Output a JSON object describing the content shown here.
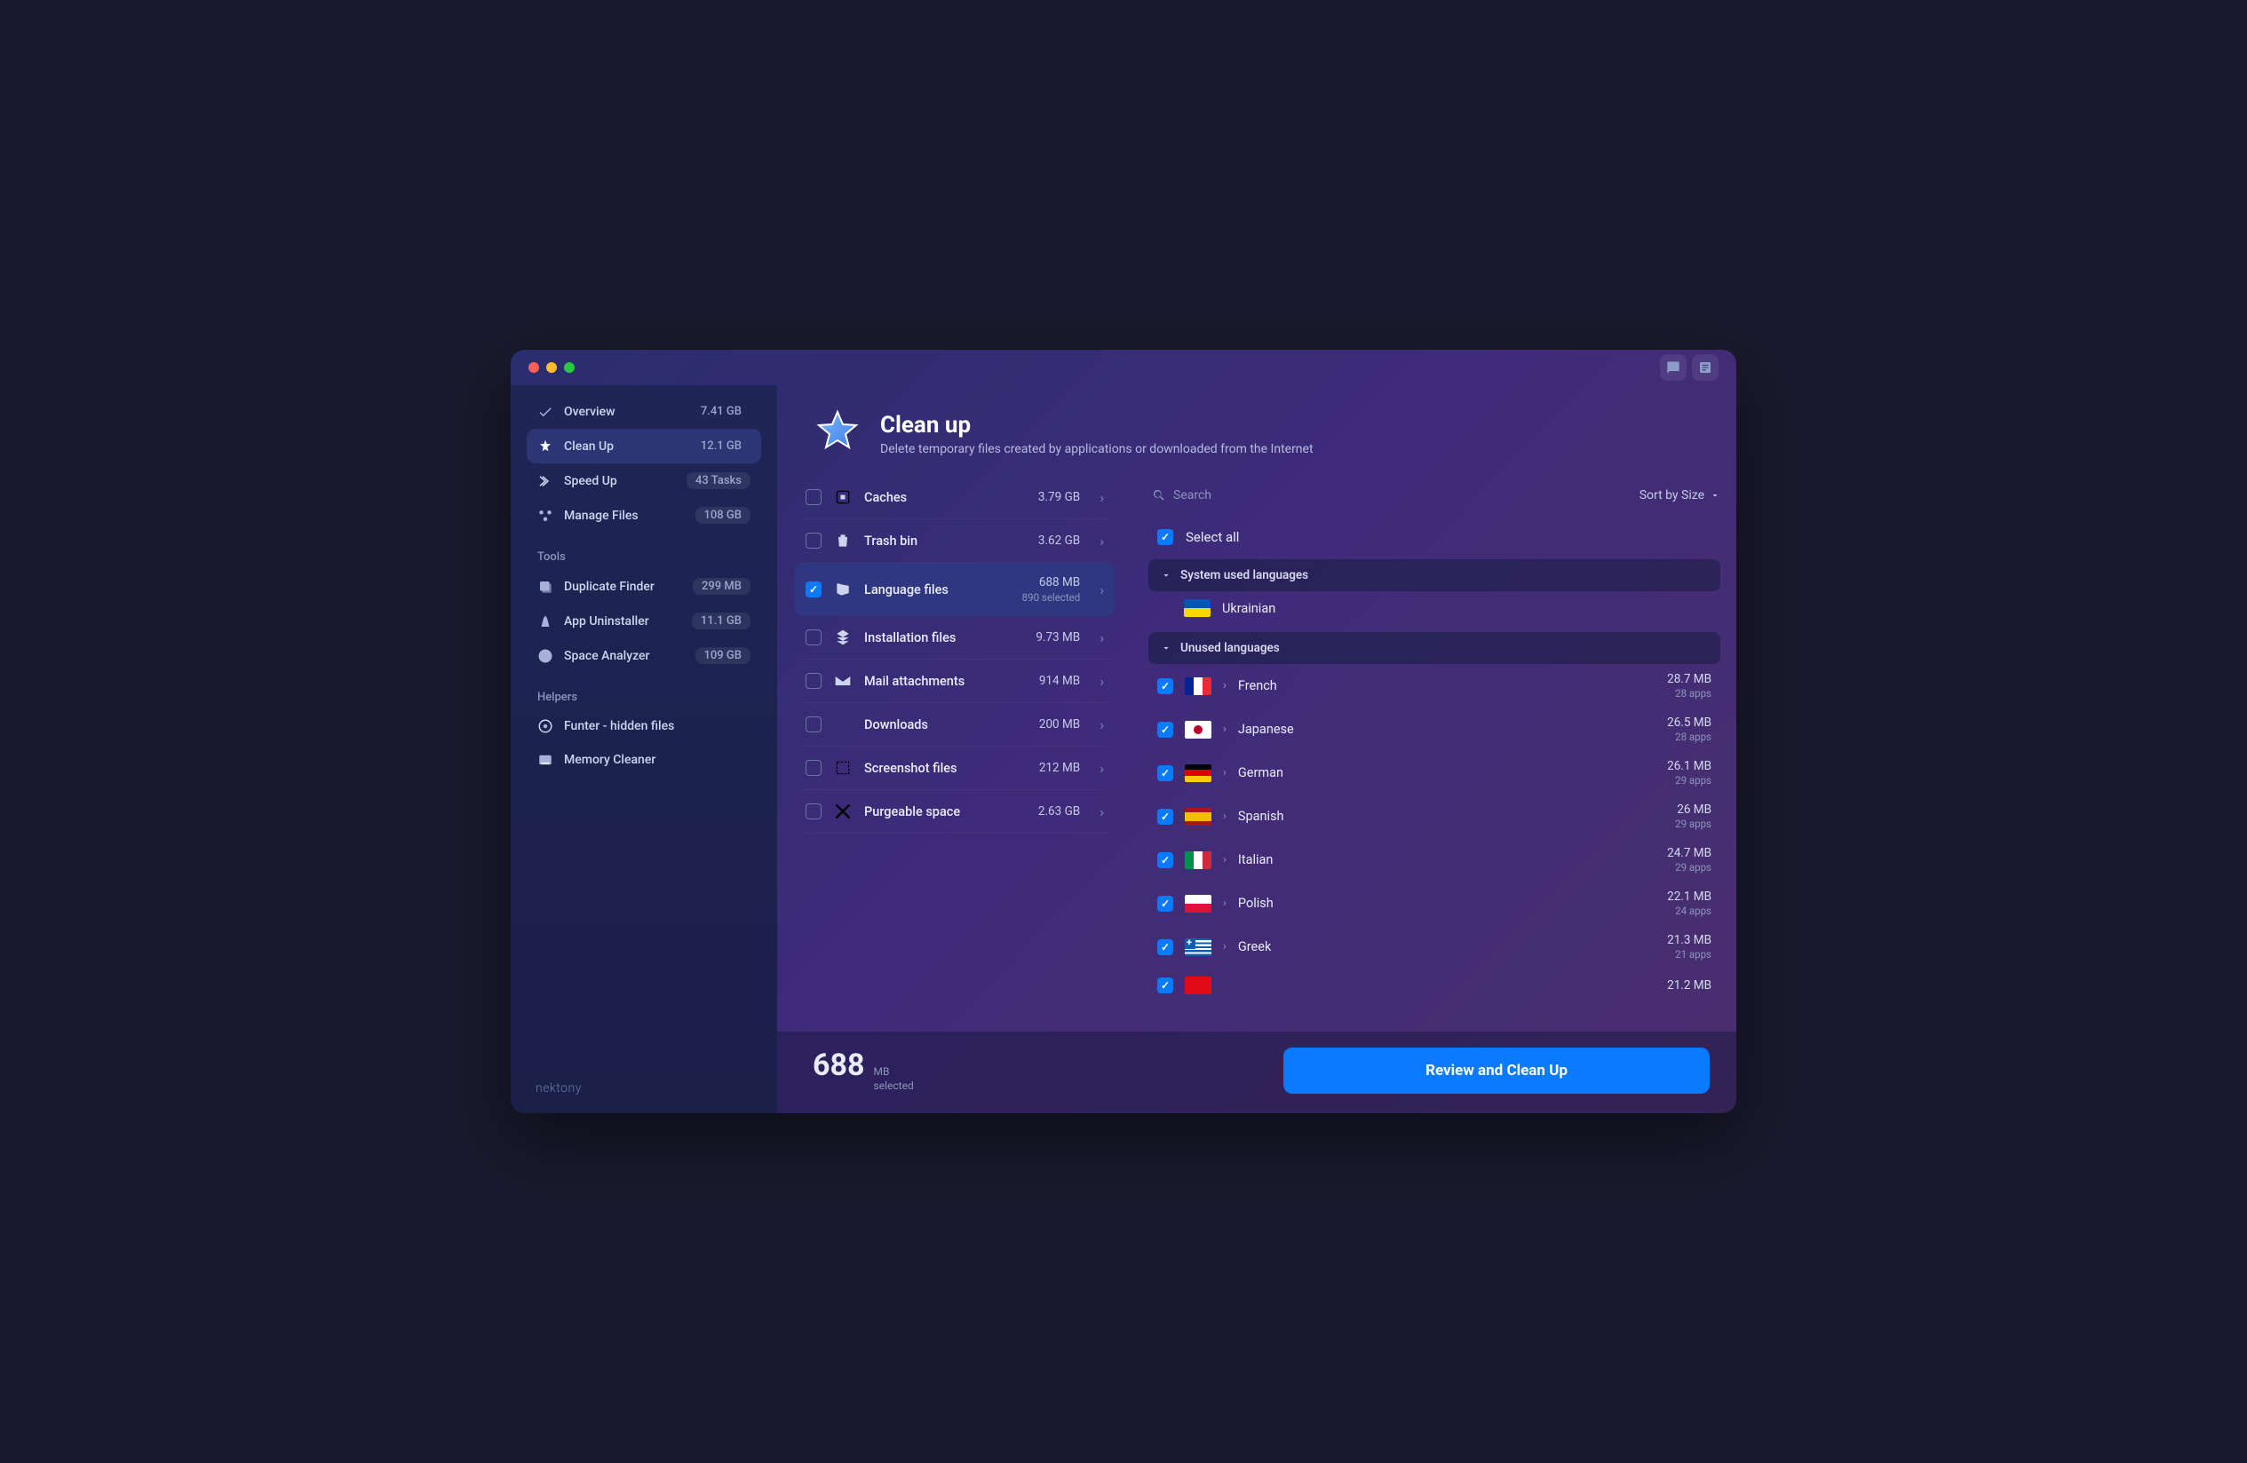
{
  "page": {
    "title": "Clean up",
    "subtitle": "Delete temporary files created by applications or downloaded from the Internet"
  },
  "brand": "nektony",
  "sidebar": {
    "main": [
      {
        "label": "Overview",
        "badge": "7.41 GB",
        "active": false
      },
      {
        "label": "Clean Up",
        "badge": "12.1 GB",
        "active": true
      },
      {
        "label": "Speed Up",
        "badge": "43 Tasks",
        "active": false,
        "pill": true
      },
      {
        "label": "Manage Files",
        "badge": "108 GB",
        "active": false,
        "pill": true
      }
    ],
    "tools_title": "Tools",
    "tools": [
      {
        "label": "Duplicate Finder",
        "badge": "299 MB",
        "pill": true
      },
      {
        "label": "App Uninstaller",
        "badge": "11.1 GB",
        "pill": true
      },
      {
        "label": "Space Analyzer",
        "badge": "109 GB",
        "pill": true
      }
    ],
    "helpers_title": "Helpers",
    "helpers": [
      {
        "label": "Funter - hidden files"
      },
      {
        "label": "Memory Cleaner"
      }
    ]
  },
  "categories": [
    {
      "label": "Caches",
      "size": "3.79 GB",
      "checked": false,
      "active": false
    },
    {
      "label": "Trash bin",
      "size": "3.62 GB",
      "checked": false,
      "active": false
    },
    {
      "label": "Language files",
      "size": "688 MB",
      "sub": "890 selected",
      "checked": true,
      "active": true
    },
    {
      "label": "Installation files",
      "size": "9.73 MB",
      "checked": false,
      "active": false
    },
    {
      "label": "Mail attachments",
      "size": "914 MB",
      "checked": false,
      "active": false
    },
    {
      "label": "Downloads",
      "size": "200 MB",
      "checked": false,
      "active": false
    },
    {
      "label": "Screenshot files",
      "size": "212 MB",
      "checked": false,
      "active": false
    },
    {
      "label": "Purgeable space",
      "size": "2.63 GB",
      "checked": false,
      "active": false
    }
  ],
  "details": {
    "search_placeholder": "Search",
    "sort_label": "Sort by Size",
    "select_all": "Select all",
    "group_system": "System used languages",
    "group_unused": "Unused languages",
    "system_lang": "Ukrainian",
    "languages": [
      {
        "name": "French",
        "size": "28.7 MB",
        "apps": "28 apps",
        "flag": "france"
      },
      {
        "name": "Japanese",
        "size": "26.5 MB",
        "apps": "28 apps",
        "flag": "japan"
      },
      {
        "name": "German",
        "size": "26.1 MB",
        "apps": "29 apps",
        "flag": "germany"
      },
      {
        "name": "Spanish",
        "size": "26 MB",
        "apps": "29 apps",
        "flag": "spain"
      },
      {
        "name": "Italian",
        "size": "24.7 MB",
        "apps": "29 apps",
        "flag": "italy"
      },
      {
        "name": "Polish",
        "size": "22.1 MB",
        "apps": "24 apps",
        "flag": "poland"
      },
      {
        "name": "Greek",
        "size": "21.3 MB",
        "apps": "21 apps",
        "flag": "greece"
      }
    ],
    "partial_size": "21.2 MB"
  },
  "footer": {
    "total_num": "688",
    "total_unit": "MB",
    "total_sub": "selected",
    "button": "Review and Clean Up"
  }
}
